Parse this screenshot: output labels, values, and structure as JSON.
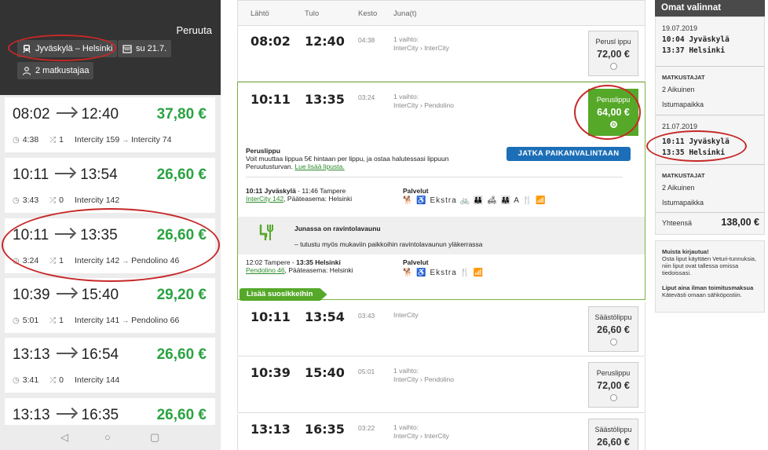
{
  "mobile": {
    "cancel_label": "Peruuta",
    "route": "Jyväskylä – Helsinki",
    "date": "su 21.7.",
    "passengers": "2 matkustajaa",
    "cards": [
      {
        "dep": "08:02",
        "arr": "12:40",
        "price": "37,80 €",
        "duration": "4:38",
        "changes": "1",
        "trains": [
          "Intercity 159",
          "Intercity 74"
        ]
      },
      {
        "dep": "10:11",
        "arr": "13:54",
        "price": "26,60 €",
        "duration": "3:43",
        "changes": "0",
        "trains": [
          "Intercity 142"
        ]
      },
      {
        "dep": "10:11",
        "arr": "13:35",
        "price": "26,60 €",
        "duration": "3:24",
        "changes": "1",
        "trains": [
          "Intercity 142",
          "Pendolino 46"
        ]
      },
      {
        "dep": "10:39",
        "arr": "15:40",
        "price": "29,20 €",
        "duration": "5:01",
        "changes": "1",
        "trains": [
          "Intercity 141",
          "Pendolino 66"
        ]
      },
      {
        "dep": "13:13",
        "arr": "16:54",
        "price": "26,60 €",
        "duration": "3:41",
        "changes": "0",
        "trains": [
          "Intercity 144"
        ]
      },
      {
        "dep": "13:13",
        "arr": "16:35",
        "price": "26,60 €"
      }
    ]
  },
  "results": {
    "headers": {
      "dep": "Lähtö",
      "arr": "Tulo",
      "dur": "Kesto",
      "trains": "Juna(t)"
    },
    "rows": [
      {
        "dep": "08:02",
        "arr": "12:40",
        "dur": "04:38",
        "line1": "1 vaihto:",
        "line2": "InterCity › InterCity",
        "fare_type": "Perusl ippu",
        "fare_price": "72,00 €"
      },
      {
        "dep": "10:11",
        "arr": "13:54",
        "dur": "03:43",
        "line1": "InterCity",
        "line2": "",
        "fare_type": "Säästölippu",
        "fare_price": "26,60 €"
      },
      {
        "dep": "10:39",
        "arr": "15:40",
        "dur": "05:01",
        "line1": "1 vaihto:",
        "line2": "InterCity › Pendolino",
        "fare_type": "Peruslippu",
        "fare_price": "72,00 €"
      },
      {
        "dep": "13:13",
        "arr": "16:35",
        "dur": "03:22",
        "line1": "1 vaihto:",
        "line2": "InterCity › InterCity",
        "fare_type": "Säästölippu",
        "fare_price": "26,60 €"
      }
    ],
    "expanded": {
      "dep": "10:11",
      "arr": "13:35",
      "dur": "03:24",
      "line1": "1 vaihto:",
      "line2": "InterCity › Pendolino",
      "fare_type": "Peruslippu",
      "fare_price": "64,00 €",
      "ticket_title": "Peruslippu",
      "ticket_text1": "Voit muuttaa lippua 5€ hintaan per lippu, ja ostaa halutessasi lippuun",
      "ticket_text2": "Peruutusturvan.",
      "read_more": "Lue lisää lipusta.",
      "continue_button": "JATKA PAIKANVALINTAAN",
      "leg1_title": "10:11 Jyväskylä",
      "leg1_rest": " - 11:46 Tampere",
      "leg1_train": "InterCity 142",
      "leg1_dest": ", Pääteasema: Helsinki",
      "services_label": "Palvelut",
      "leg1_services": "🐕 ♿ Ekstra 🚲 👪 🛋 👨‍👩‍👧 A 🍴 📶",
      "restaurant_title": "Junassa on ravintolavaunu",
      "restaurant_text": "– tutustu myös mukaviin paikkoihin ravintolavaunun yläkerrassa",
      "leg2_title_a": "12:02 Tampere - ",
      "leg2_title_b": "13:35 Helsinki",
      "leg2_train": "Pendolino 46",
      "leg2_dest": ", Pääteasema: Helsinki",
      "leg2_services": "🐕 ♿ Ekstra 🍴 📶",
      "favorite_button": "Lisää suosikkeihin"
    }
  },
  "sidebar": {
    "title": "Omat valinnat",
    "out_date": "19.07.2019",
    "out_dep": "10:04 Jyväskylä",
    "out_arr": "13:37 Helsinki",
    "passengers_label": "MATKUSTAJAT",
    "out_pax": "2 Aikuinen",
    "out_seat": "Istumapaikka",
    "ret_date": "21.07.2019",
    "ret_dep": "10:11 Jyväskylä",
    "ret_arr": "13:35 Helsinki",
    "ret_pax": "2 Aikuinen",
    "ret_seat": "Istumapaikka",
    "total_label": "Yhteensä",
    "total_price": "138,00 €",
    "info_title": "Muista kirjautua!",
    "info_text": "Osta liput käyttäen Veturi-tunnuksia, niin liput ovat tallessa omissa tiedoissasi.",
    "info2_title": "Liput aina ilman toimitusmaksua",
    "info2_text": "Kätevästi omaan sähköpostiin."
  },
  "colors": {
    "accent_green": "#56a829",
    "price_green": "#2aa342",
    "button_blue": "#1c6fb7",
    "annotation_red": "#c62828"
  }
}
